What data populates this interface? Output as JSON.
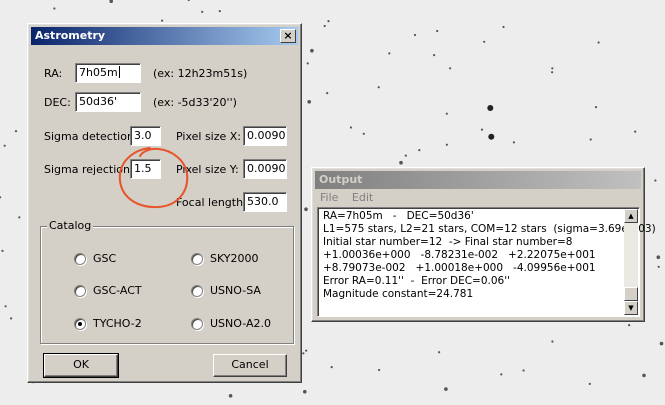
{
  "astrometry": {
    "title": "Astrometry",
    "close_glyph": "×",
    "ra": {
      "label": "RA:",
      "value": "7h05m",
      "example": "(ex: 12h23m51s)"
    },
    "dec": {
      "label": "DEC:",
      "value": "50d36'",
      "example": "(ex: -5d33'20'')"
    },
    "sigma_detection": {
      "label": "Sigma detection:",
      "value": "3.0"
    },
    "sigma_rejection": {
      "label": "Sigma rejection:",
      "value": "1.5"
    },
    "pixel_size_x": {
      "label": "Pixel size X:",
      "value": "0.0090"
    },
    "pixel_size_y": {
      "label": "Pixel size Y:",
      "value": "0.0090"
    },
    "focal_length": {
      "label": "Focal length:",
      "value": "530.0"
    },
    "catalog": {
      "label": "Catalog",
      "options": [
        "GSC",
        "SKY2000",
        "GSC-ACT",
        "USNO-SA",
        "TYCHO-2",
        "USNO-A2.0"
      ],
      "selected": "TYCHO-2"
    },
    "ok_label": "OK",
    "cancel_label": "Cancel"
  },
  "output": {
    "title": "Output",
    "menu": [
      "File",
      "Edit"
    ],
    "lines": [
      "RA=7h05m   -   DEC=50d36'",
      "L1=575 stars, L2=21 stars, COM=12 stars  (sigma=3.69e-003)",
      "Initial star number=12  -> Final star number=8",
      "+1.00036e+000   -8.78231e-002   +2.22075e+001",
      "+8.79073e-002   +1.00018e+000   -4.09956e+001",
      "Error RA=0.11''  -  Error DEC=0.06''",
      "Magnitude constant=24.781"
    ]
  },
  "colors": {
    "titlebar_active": "#0a246a",
    "titlebar_inactive": "#808080",
    "window_face": "#d4d0c8",
    "annotation": "#e8542a"
  },
  "icons": {
    "close": "close-icon",
    "scroll_up": "scroll-up-arrow-icon",
    "scroll_down": "scroll-down-arrow-icon"
  }
}
